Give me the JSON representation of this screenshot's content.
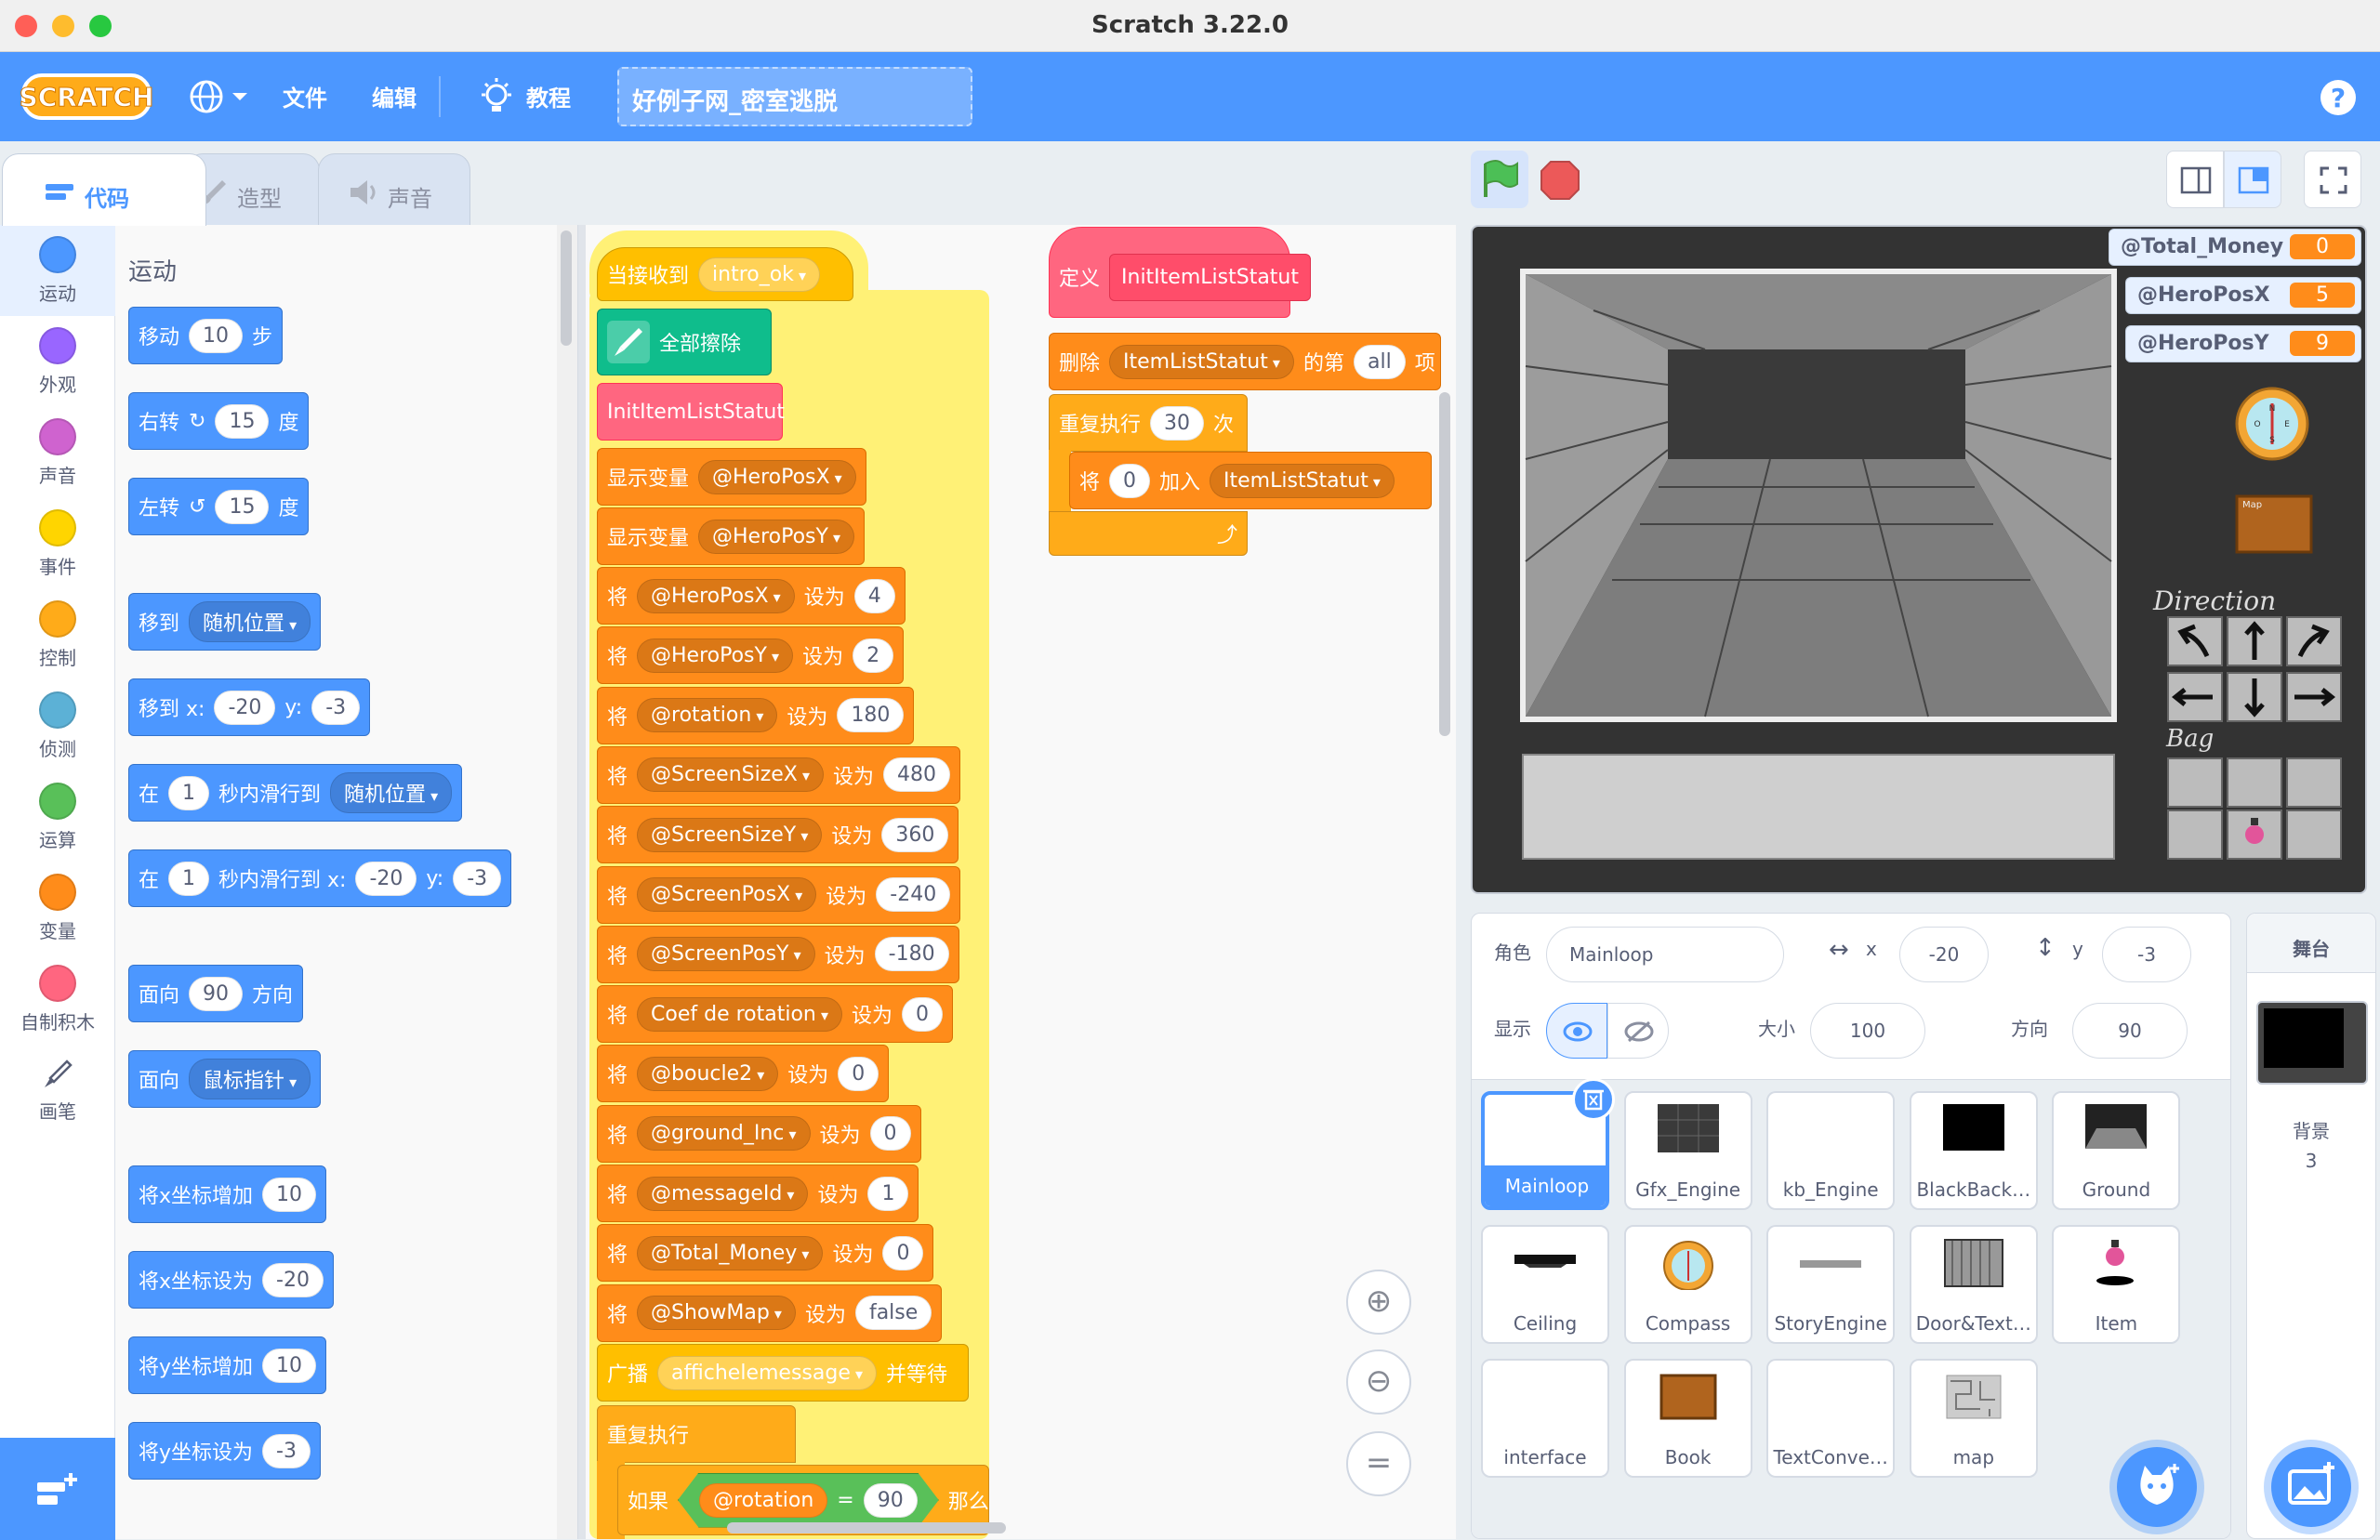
{
  "window": {
    "title": "Scratch 3.22.0"
  },
  "menu": {
    "file": "文件",
    "edit": "编辑",
    "tutorials": "教程",
    "project_name": "好例子网_密室逃脱"
  },
  "tabs": {
    "code": "代码",
    "costumes": "造型",
    "sounds": "声音"
  },
  "categories": [
    "运动",
    "外观",
    "声音",
    "事件",
    "控制",
    "侦测",
    "运算",
    "变量",
    "自制积木",
    "画笔"
  ],
  "category_colors": [
    "#4c97ff",
    "#9966ff",
    "#cf63cf",
    "#ffd500",
    "#ffab19",
    "#5cb1d6",
    "#59c059",
    "#ff8c1a",
    "#ff6680",
    "#0fbd8c"
  ],
  "palette": {
    "title": "运动",
    "move": {
      "a": "移动",
      "v": "10",
      "b": "步"
    },
    "turn_right": {
      "a": "右转",
      "v": "15",
      "b": "度"
    },
    "turn_left": {
      "a": "左转",
      "v": "15",
      "b": "度"
    },
    "goto": {
      "a": "移到",
      "dd": "随机位置"
    },
    "goto_xy": {
      "a": "移到 x:",
      "x": "-20",
      "b": "y:",
      "y": "-3"
    },
    "glide": {
      "a": "在",
      "v": "1",
      "b": "秒内滑行到",
      "dd": "随机位置"
    },
    "glide_xy": {
      "a": "在",
      "v": "1",
      "b": "秒内滑行到 x:",
      "x": "-20",
      "c": "y:",
      "y": "-3"
    },
    "point_dir": {
      "a": "面向",
      "v": "90",
      "b": "方向"
    },
    "point_towards": {
      "a": "面向",
      "dd": "鼠标指针"
    },
    "change_x": {
      "a": "将x坐标增加",
      "v": "10"
    },
    "set_x": {
      "a": "将x坐标设为",
      "v": "-20"
    },
    "change_y": {
      "a": "将y坐标增加",
      "v": "10"
    },
    "set_y": {
      "a": "将y坐标设为",
      "v": "-3"
    }
  },
  "script1": {
    "hat": {
      "a": "当接收到",
      "dd": "intro_ok"
    },
    "clear": "全部擦除",
    "call": "InitItemListStatut",
    "show1": {
      "a": "显示变量",
      "dd": "@HeroPosX"
    },
    "show2": {
      "a": "显示变量",
      "dd": "@HeroPosY"
    },
    "sets": [
      {
        "var": "@HeroPosX",
        "val": "4"
      },
      {
        "var": "@HeroPosY",
        "val": "2"
      },
      {
        "var": "@rotation",
        "val": "180"
      },
      {
        "var": "@ScreenSizeX",
        "val": "480"
      },
      {
        "var": "@ScreenSizeY",
        "val": "360"
      },
      {
        "var": "@ScreenPosX",
        "val": "-240"
      },
      {
        "var": "@ScreenPosY",
        "val": "-180"
      },
      {
        "var": "Coef de rotation",
        "val": "0"
      },
      {
        "var": "@boucle2",
        "val": "0"
      },
      {
        "var": "@ground_Inc",
        "val": "0"
      },
      {
        "var": "@messageId",
        "val": "1"
      },
      {
        "var": "@Total_Money",
        "val": "0"
      },
      {
        "var": "@ShowMap",
        "val": "false"
      }
    ],
    "set_a": "将",
    "set_b": "设为",
    "broadcast": {
      "a": "广播",
      "dd": "affichelemessage",
      "b": "并等待"
    },
    "forever": "重复执行",
    "if": {
      "a": "如果",
      "var": "@rotation",
      "op": "=",
      "val": "90",
      "b": "那么"
    }
  },
  "script2": {
    "define": {
      "a": "定义",
      "name": "InitItemListStatut"
    },
    "delete": {
      "a": "删除",
      "dd": "ItemListStatut",
      "b": "的第",
      "v": "all",
      "c": "项"
    },
    "repeat": {
      "a": "重复执行",
      "v": "30",
      "b": "次"
    },
    "add": {
      "a": "将",
      "v": "0",
      "b": "加入",
      "dd": "ItemListStatut"
    }
  },
  "monitors": [
    {
      "name": "@Total_Money",
      "value": "0"
    },
    {
      "name": "@HeroPosX",
      "value": "5"
    },
    {
      "name": "@HeroPosY",
      "value": "9"
    }
  ],
  "stage_hud": {
    "direction": "Direction",
    "bag": "Bag",
    "compass": "N O E S",
    "map": "Map"
  },
  "sprite_info": {
    "label_sprite": "角色",
    "name": "Mainloop",
    "x_label": "x",
    "x": "-20",
    "y_label": "y",
    "y": "-3",
    "show": "显示",
    "size_label": "大小",
    "size": "100",
    "dir_label": "方向",
    "dir": "90"
  },
  "sprites": [
    "Mainloop",
    "Gfx_Engine",
    "kb_Engine",
    "BlackBack…",
    "Ground",
    "Ceiling",
    "Compass",
    "StoryEngine",
    "Door&Text…",
    "Item",
    "interface",
    "Book",
    "TextConve…",
    "map"
  ],
  "stage_panel": {
    "title": "舞台",
    "backdrops_label": "背景",
    "backdrops_count": "3"
  }
}
